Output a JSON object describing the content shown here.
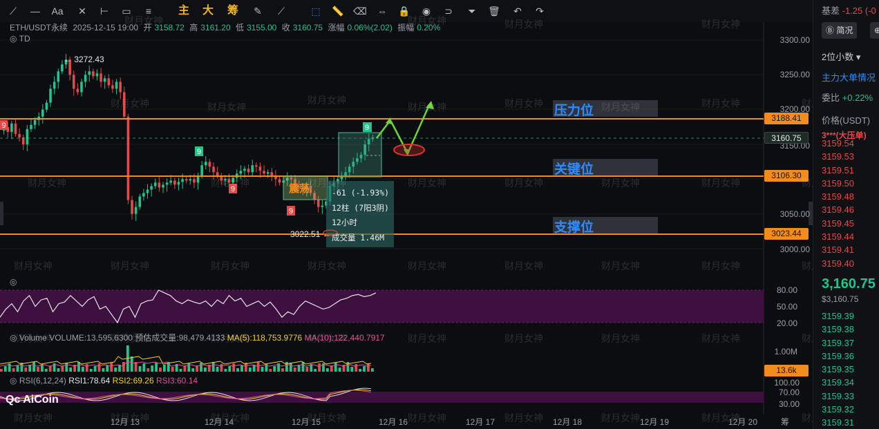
{
  "toolbar": {
    "tools": [
      "trend-line-tool",
      "horizontal-line-tool",
      "parallel-line-tool",
      "text-tool",
      "measure-tool",
      "ray-tool",
      "rect-tool",
      "pattern-tool",
      "magnet-tool",
      "indicator-tool"
    ],
    "labels": {
      "main": "主",
      "big": "大",
      "chips": "筹",
      "aa": "Aa"
    }
  },
  "chart_header": {
    "symbol": "ETH/USDT永续",
    "datetime": "2025-12-15 19:00",
    "open_label": "开",
    "open": "3158.72",
    "high_label": "高",
    "high": "3161.20",
    "low_label": "低",
    "low": "3155.00",
    "close_label": "收",
    "close": "3160.75",
    "change_label": "涨幅",
    "change": "0.06%(2.02)",
    "amp_label": "振幅",
    "amp": "0.20%",
    "td_label": "TD"
  },
  "levels": {
    "resistance": {
      "label": "压力位",
      "price": "3188.41"
    },
    "key": {
      "label": "关键位",
      "price": "3106.30"
    },
    "support": {
      "label": "支撑位",
      "price": "3023.44"
    },
    "current": "3160.75"
  },
  "price_axis": [
    "3300.00",
    "3250.00",
    "3200.00",
    "3150.00",
    "3050.00",
    "3000.00"
  ],
  "annotations": {
    "high_mark": "← 3272.43",
    "low_mark": "3022.51 ←",
    "consolidation": "震荡",
    "measure": [
      "-61 (-1.93%)",
      "12柱 (7阳3阴)",
      "12小时",
      "成交量 1.46M"
    ],
    "td_nine": "9"
  },
  "rsi_top": {
    "levels": [
      "80.00",
      "50.00",
      "20.00"
    ]
  },
  "volume": {
    "label": "Volume",
    "volume_text": "VOLUME:13,595.6300",
    "est_text": "预估成交量:98,479.4133",
    "ma5": "MA(5):118,753.9776",
    "ma10": "MA(10):122,440.7917",
    "axis": "1.00M",
    "tag": "13.6k"
  },
  "rsi": {
    "label": "RSI(6,12,24)",
    "rsi1": "RSI1:78.64",
    "rsi2": "RSI2:69.26",
    "rsi3": "RSI3:60.14",
    "axis": [
      "100.00",
      "70.00",
      "30.00"
    ]
  },
  "x_axis": [
    "12月 13",
    "12月 14",
    "12月 15",
    "12月 16",
    "12月 17",
    "12月 18",
    "12月 19",
    "12月 20"
  ],
  "logo": "AiCoin",
  "watermark": "财月女神",
  "right_panel": {
    "base_label": "基差",
    "base_value": "-1.25 (-0",
    "btn_brief": "简况",
    "decimals": "2位小数 ▾",
    "main_order": "主力大单情况",
    "change_prefix": "委比",
    "change_value": "+0.22%",
    "price_header": "价格(USDT)",
    "big_order": "3***(大压单)",
    "ask_prices": [
      "3159.54",
      "3159.53",
      "3159.51",
      "3159.50",
      "3159.48",
      "3159.46",
      "3159.45",
      "3159.44",
      "3159.41",
      "3159.40"
    ],
    "last_price": "3,160.75",
    "last_price_sub": "$3,160.75",
    "bid_prices": [
      "3159.39",
      "3159.38",
      "3159.37",
      "3159.36",
      "3159.35",
      "3159.34",
      "3159.33",
      "3159.32",
      "3159.31"
    ]
  },
  "colors": {
    "up": "#22c58b",
    "down": "#e34a4a",
    "level": "#f28d1c",
    "accent": "#2e8cff",
    "rsi_band": "#3d1040"
  }
}
